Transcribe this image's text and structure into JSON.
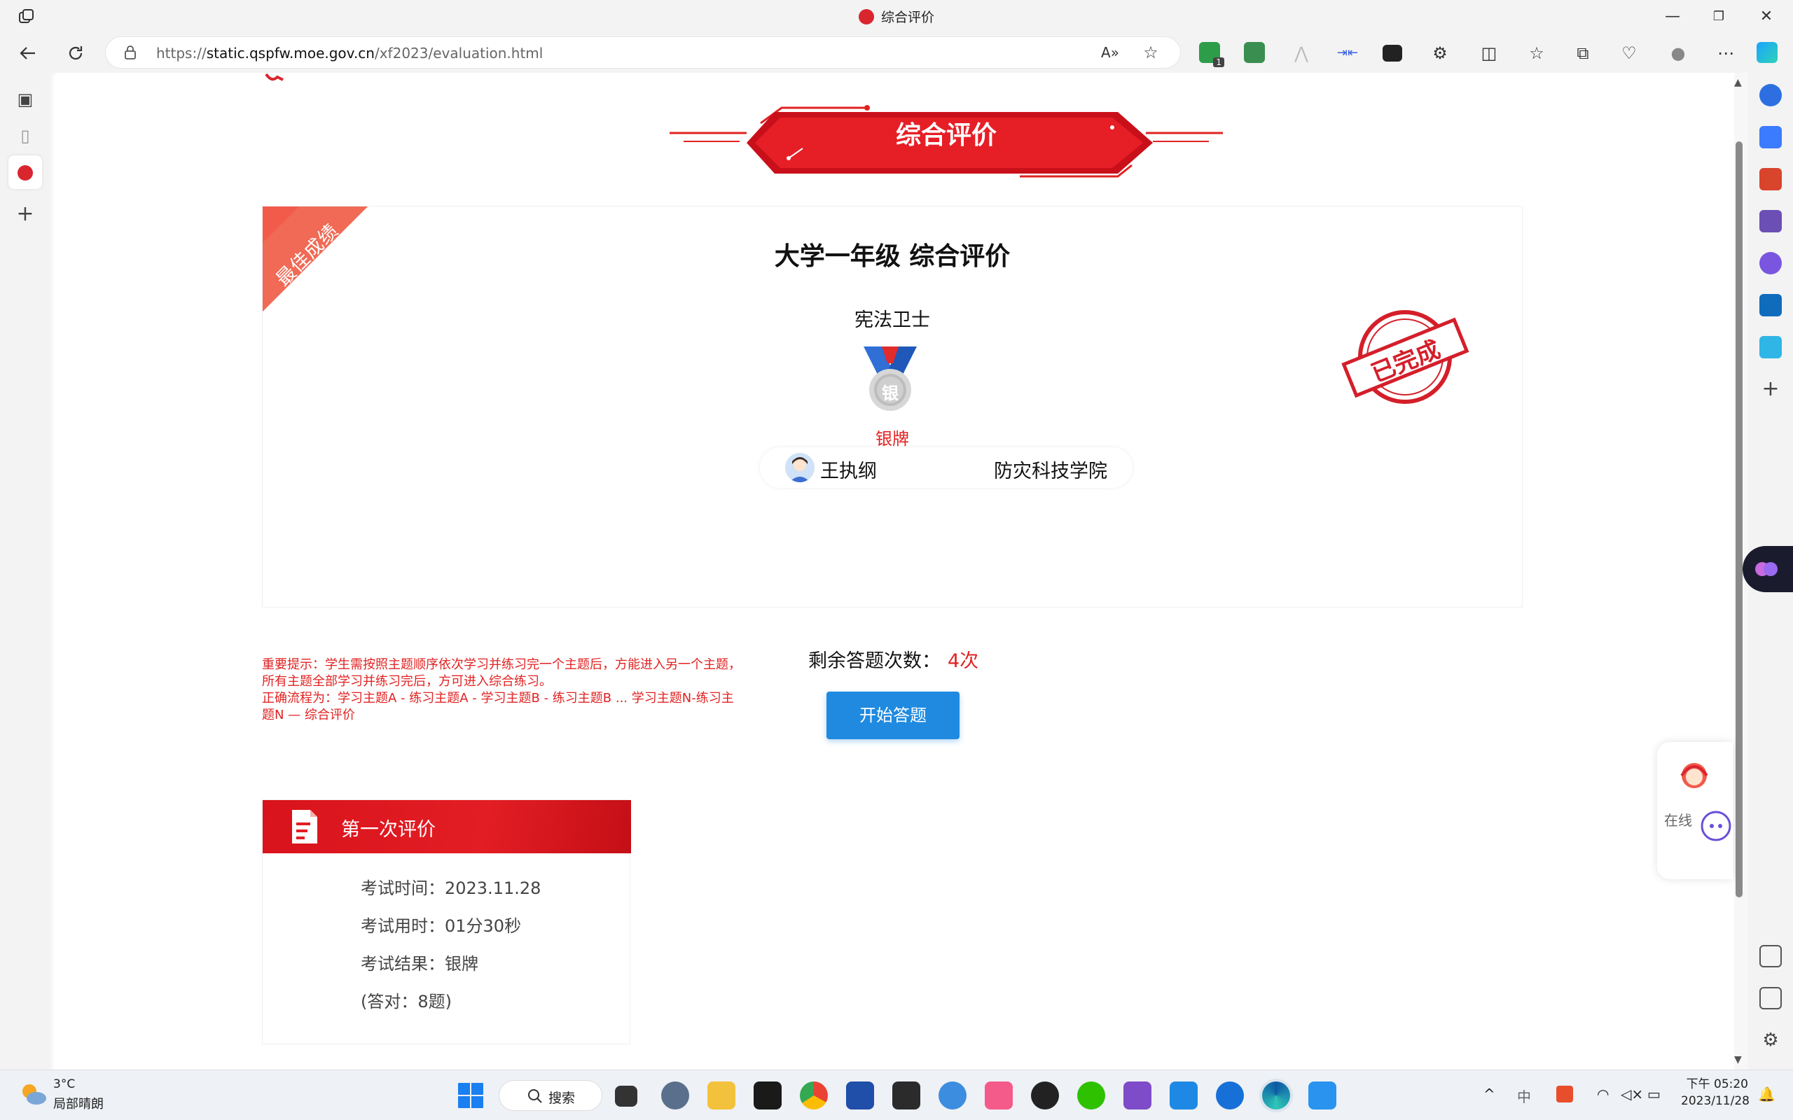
{
  "window": {
    "title": "综合评价",
    "controls": {
      "minimize": "—",
      "restore": "❐",
      "close": "✕"
    }
  },
  "toolbar": {
    "url_prefix": "https://",
    "url_host": "static.qspfw.moe.gov.cn",
    "url_path": "/xf2023/evaluation.html",
    "ext_badge": "1"
  },
  "page": {
    "banner_title": "综合评价",
    "ribbon": "最佳成绩",
    "card_title": "大学一年级 综合评价",
    "honor_title": "宪法卫士",
    "medal_char": "银",
    "medal_label": "银牌",
    "user_name": "王执纲",
    "school": "防灾科技学院",
    "stamp_text": "已完成",
    "notice_line1": "重要提示：学生需按照主题顺序依次学习并练习完一个主题后，方能进入另一个主题，所有主题全部学习并练习完后，方可进入综合练习。",
    "notice_line2": "正确流程为：学习主题A - 练习主题A - 学习主题B - 练习主题B ... 学习主题N-练习主题N — 综合评价",
    "remain_label": "剩余答题次数：",
    "remain_count": "4次",
    "start_button": "开始答题",
    "record": {
      "title": "第一次评价",
      "time": "考试时间：2023.11.28",
      "duration": "考试用时：01分30秒",
      "result": "考试结果：银牌",
      "correct": "(答对：8题)"
    },
    "service_text": "在线"
  },
  "taskbar": {
    "temp": "3°C",
    "weather": "局部晴朗",
    "search": "搜索",
    "ime": "中",
    "time": "下午 05:20",
    "date": "2023/11/28"
  },
  "colors": {
    "brand_red": "#e12222",
    "button_blue": "#1f8ae0"
  }
}
